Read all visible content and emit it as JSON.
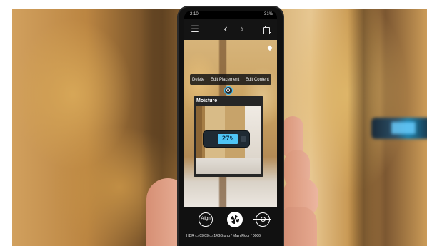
{
  "phone": {
    "status_bar": {
      "time": "2:10",
      "right": "31%"
    },
    "top_bar": {
      "menu_icon": "menu-icon",
      "back_icon": "chevron-left-icon",
      "forward_icon": "chevron-right-icon",
      "copy_icon": "copy-icon"
    },
    "tag_icon": "tag-icon",
    "actions": [
      "Delete",
      "Edit Placement",
      "Edit Content"
    ],
    "card": {
      "title": "Moisture",
      "meter_reading": "27%"
    },
    "bottom_bar": {
      "align_label": "Align",
      "shutter_icon": "shutter-icon",
      "level_icon": "level-icon",
      "info_line": "HDR  ▭ 09:09  ▭ 14GB  png  /  Main Floor  /  0006"
    }
  },
  "colors": {
    "pin_ring": "#39c0ff",
    "lcd": "#4fc4f5"
  }
}
